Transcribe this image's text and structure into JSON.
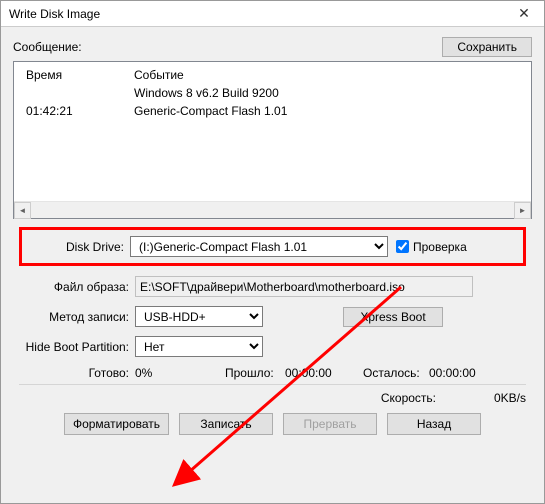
{
  "titlebar": {
    "title": "Write Disk Image",
    "close_glyph": "✕"
  },
  "message": {
    "label": "Сообщение:",
    "save_btn": "Сохранить"
  },
  "log": {
    "col_time": "Время",
    "col_event": "Событие",
    "rows": [
      {
        "time": "",
        "event": "Windows 8 v6.2 Build 9200"
      },
      {
        "time": "01:42:21",
        "event": "Generic-Compact Flash   1.01"
      }
    ],
    "scroll_left": "◄",
    "scroll_right": "►"
  },
  "drive": {
    "label": "Disk Drive:",
    "value": "(I:)Generic-Compact Flash   1.01",
    "verify_label": "Проверка"
  },
  "image_file": {
    "label": "Файл образа:",
    "value": "E:\\SOFT\\драйвери\\Motherboard\\motherboard.iso"
  },
  "write_method": {
    "label": "Метод записи:",
    "value": "USB-HDD+",
    "xpress_btn": "Xpress Boot"
  },
  "hide_boot": {
    "label": "Hide Boot Partition:",
    "value": "Нет"
  },
  "status": {
    "ready_label": "Готово:",
    "ready_value": "0%",
    "elapsed_label": "Прошло:",
    "elapsed_value": "00:00:00",
    "remain_label": "Осталось:",
    "remain_value": "00:00:00"
  },
  "speed": {
    "label": "Скорость:",
    "value": "0KB/s"
  },
  "buttons": {
    "format": "Форматировать",
    "write": "Записать",
    "abort": "Прервать",
    "back": "Назад"
  }
}
